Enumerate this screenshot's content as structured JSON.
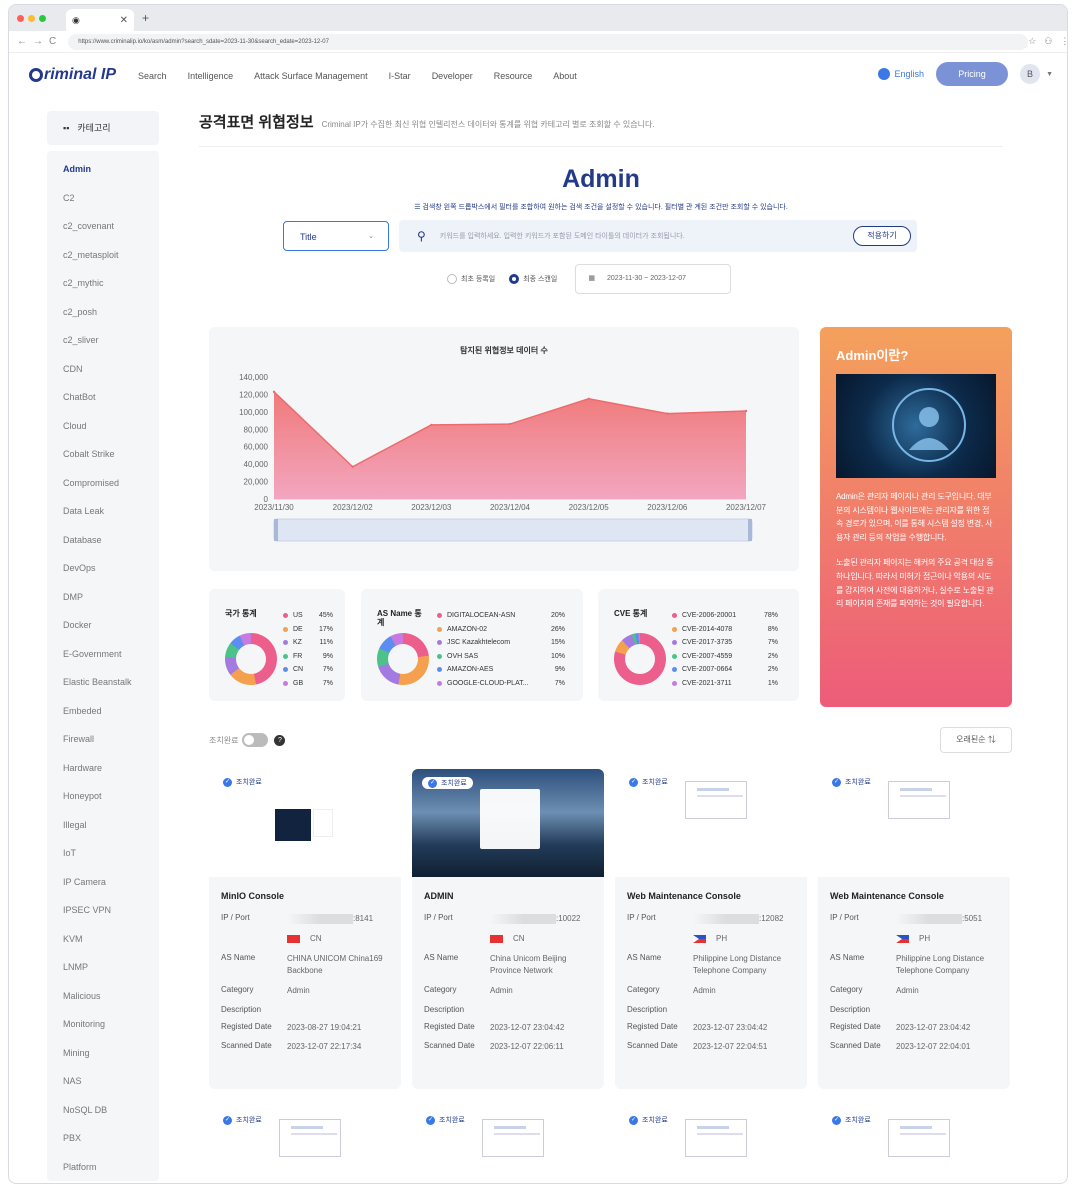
{
  "browser": {
    "tab_title": "",
    "url": "https://www.criminalip.io/ko/asm/admin?search_sdate=2023-11-30&search_edate=2023-12-07"
  },
  "header": {
    "logo": "riminal IP",
    "nav": [
      "Search",
      "Intelligence",
      "Attack Surface Management",
      "I-Star",
      "Developer",
      "Resource",
      "About"
    ],
    "language": "English",
    "pricing": "Pricing",
    "avatar": "B"
  },
  "sidebar": {
    "title": "카테고리",
    "items": [
      "Admin",
      "C2",
      "c2_covenant",
      "c2_metasploit",
      "c2_mythic",
      "c2_posh",
      "c2_sliver",
      "CDN",
      "ChatBot",
      "Cloud",
      "Cobalt Strike",
      "Compromised",
      "Data Leak",
      "Database",
      "DevOps",
      "DMP",
      "Docker",
      "E-Government",
      "Elastic Beanstalk",
      "Embeded",
      "Firewall",
      "Hardware",
      "Honeypot",
      "Illegal",
      "IoT",
      "IP Camera",
      "IPSEC VPN",
      "KVM",
      "LNMP",
      "Malicious",
      "Monitoring",
      "Mining",
      "NAS",
      "NoSQL DB",
      "PBX",
      "Platform"
    ]
  },
  "page": {
    "title": "공격표면 위협정보",
    "subtitle": "Criminal IP가 수집한 최신 위협 인텔리전스 데이터와 통계를 위협 카테고리 별로 조회할 수 있습니다.",
    "heading": "Admin",
    "hint": "검색창 왼쪽 드롭박스에서 필터를 조합하여 원하는 검색 조건을 설정할 수 있습니다. 필터별 관 계된 조건만 조회할 수 있습니다.",
    "select_value": "Title",
    "search_placeholder": "키워드를 입력하세요. 입력한 키워드가 포함된 도메인 타이틀의 데이터가 조회됩니다.",
    "apply": "적용하기",
    "radio_first": "최초 등록일",
    "radio_last": "최종 스캔일",
    "date_range": "2023-11-30 ~ 2023-12-07"
  },
  "chart_data": {
    "type": "area",
    "title": "탐지된 위협정보 데이터 수",
    "x": [
      "2023/11/30",
      "2023/12/02",
      "2023/12/03",
      "2023/12/04",
      "2023/12/05",
      "2023/12/06",
      "2023/12/07"
    ],
    "values": [
      123000,
      37000,
      85000,
      86000,
      115000,
      98000,
      101000
    ],
    "yticks": [
      "0",
      "20,000",
      "40,000",
      "60,000",
      "80,000",
      "100,000",
      "120,000",
      "140,000"
    ],
    "ylim": [
      0,
      140000
    ],
    "colors": {
      "top": "#f07a7a",
      "bottom": "#f2a6c0",
      "line": "#ef6b6b"
    }
  },
  "info": {
    "title": "Admin이란?",
    "p1": "Admin은 관리자 페이지나 관리 도구입니다. 대부분의 시스템이나 웹사이트에는 관리자를 위한 접속 경로가 있으며, 이를 통해 시스템 설정 변경, 사용자 관리 등의 작업을 수행합니다.",
    "p2": "노출된 관리자 페이지는 해커의 주요 공격 대상 중 하나입니다. 따라서 미허가 접근이나 악용의 시도를 감지하여 사전에 대응하거나, 실수로 노출된 관리 페이지의 존재를 파악하는 것이 필요합니다."
  },
  "stats": [
    {
      "title": "국가 통계",
      "items": [
        {
          "n": "US",
          "p": "45%",
          "c": "#ec5f8c"
        },
        {
          "n": "DE",
          "p": "17%",
          "c": "#f5a04e"
        },
        {
          "n": "KZ",
          "p": "11%",
          "c": "#a37be0"
        },
        {
          "n": "FR",
          "p": "9%",
          "c": "#4cc28a"
        },
        {
          "n": "CN",
          "p": "7%",
          "c": "#5b8ef0"
        },
        {
          "n": "GB",
          "p": "7%",
          "c": "#c77ae0"
        }
      ]
    },
    {
      "title": "AS Name 통계",
      "items": [
        {
          "n": "DIGITALOCEAN-ASN",
          "p": "20%",
          "c": "#ec5f8c"
        },
        {
          "n": "AMAZON-02",
          "p": "26%",
          "c": "#f5a04e"
        },
        {
          "n": "JSC Kazakhtelecom",
          "p": "15%",
          "c": "#a37be0"
        },
        {
          "n": "OVH SAS",
          "p": "10%",
          "c": "#4cc28a"
        },
        {
          "n": "AMAZON-AES",
          "p": "9%",
          "c": "#5b8ef0"
        },
        {
          "n": "GOOGLE-CLOUD-PLAT...",
          "p": "7%",
          "c": "#c77ae0"
        }
      ]
    },
    {
      "title": "CVE 통계",
      "items": [
        {
          "n": "CVE-2006-20001",
          "p": "78%",
          "c": "#ec5f8c"
        },
        {
          "n": "CVE-2014-4078",
          "p": "8%",
          "c": "#f5a04e"
        },
        {
          "n": "CVE-2017-3735",
          "p": "7%",
          "c": "#a37be0"
        },
        {
          "n": "CVE-2007-4559",
          "p": "2%",
          "c": "#4cc28a"
        },
        {
          "n": "CVE-2007-0664",
          "p": "2%",
          "c": "#5b8ef0"
        },
        {
          "n": "CVE-2021-3711",
          "p": "1%",
          "c": "#c77ae0"
        }
      ]
    }
  ],
  "toolbar": {
    "toggle_label": "조치완료",
    "sort": "오래된순"
  },
  "card_labels": {
    "badge": "조치완료",
    "ip": "IP / Port",
    "as": "AS Name",
    "category": "Category",
    "description": "Description",
    "registed": "Registed Date",
    "scanned": "Scanned Date"
  },
  "cards": [
    {
      "title": "MinIO Console",
      "port": ":8141",
      "country": "CN",
      "as": "CHINA UNICOM China169 Backbone",
      "category": "Admin",
      "registed": "2023-08-27 19:04:21",
      "scanned": "2023-12-07 22:17:34"
    },
    {
      "title": "ADMIN",
      "port": ":10022",
      "country": "CN",
      "as": "China Unicom Beijing Province Network",
      "category": "Admin",
      "registed": "2023-12-07 23:04:42",
      "scanned": "2023-12-07 22:06:11"
    },
    {
      "title": "Web Maintenance Console",
      "port": ":12082",
      "country": "PH",
      "as": "Philippine Long Distance Telephone Company",
      "category": "Admin",
      "registed": "2023-12-07 23:04:42",
      "scanned": "2023-12-07 22:04:51"
    },
    {
      "title": "Web Maintenance Console",
      "port": ":5051",
      "country": "PH",
      "as": "Philippine Long Distance Telephone Company",
      "category": "Admin",
      "registed": "2023-12-07 23:04:42",
      "scanned": "2023-12-07 22:04:01"
    }
  ]
}
